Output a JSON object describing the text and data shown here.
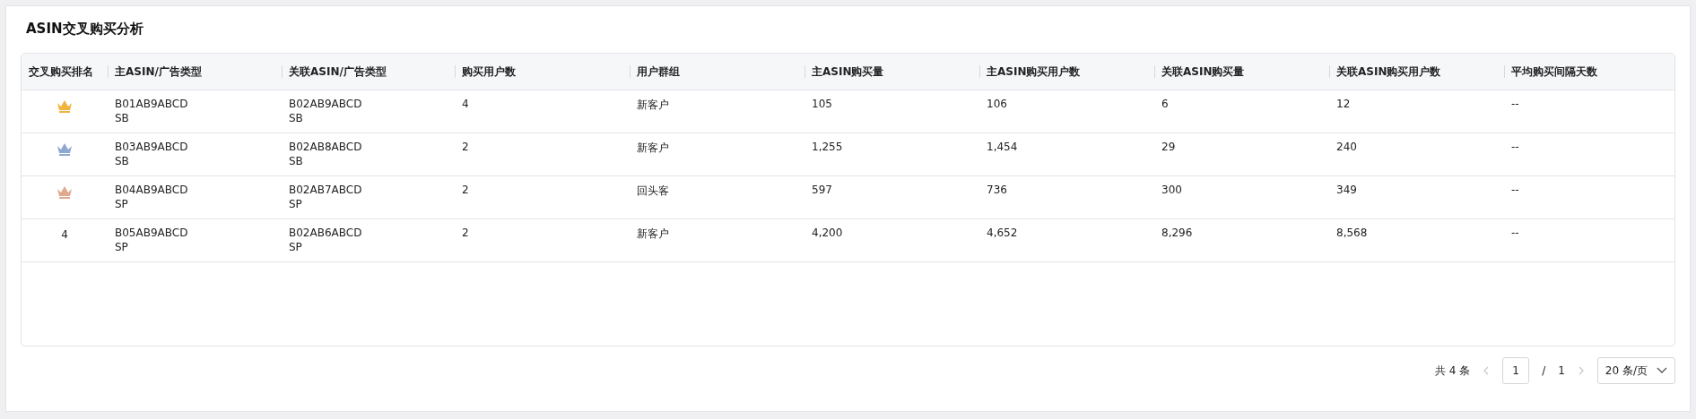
{
  "title": "ASIN交叉购买分析",
  "table": {
    "columns": [
      "交叉购买排名",
      "主ASIN/广告类型",
      "关联ASIN/广告类型",
      "购买用户数",
      "用户群组",
      "主ASIN购买量",
      "主ASIN购买用户数",
      "关联ASIN购买量",
      "关联ASIN购买用户数",
      "平均购买间隔天数"
    ],
    "rows": [
      {
        "rank": {
          "kind": "crown",
          "color": "#f2b33d"
        },
        "main_asin": "B01AB9ABCD",
        "main_ad_type": "SB",
        "related_asin": "B02AB9ABCD",
        "related_ad_type": "SB",
        "buyers": "4",
        "group": "新客户",
        "main_qty": "105",
        "main_buyers": "106",
        "related_qty": "6",
        "related_buyers": "12",
        "avg_interval": "--"
      },
      {
        "rank": {
          "kind": "crown",
          "color": "#8fa8d0"
        },
        "main_asin": "B03AB9ABCD",
        "main_ad_type": "SB",
        "related_asin": "B02AB8ABCD",
        "related_ad_type": "SB",
        "buyers": "2",
        "group": "新客户",
        "main_qty": "1,255",
        "main_buyers": "1,454",
        "related_qty": "29",
        "related_buyers": "240",
        "avg_interval": "--"
      },
      {
        "rank": {
          "kind": "crown",
          "color": "#e0a98f"
        },
        "main_asin": "B04AB9ABCD",
        "main_ad_type": "SP",
        "related_asin": "B02AB7ABCD",
        "related_ad_type": "SP",
        "buyers": "2",
        "group": "回头客",
        "main_qty": "597",
        "main_buyers": "736",
        "related_qty": "300",
        "related_buyers": "349",
        "avg_interval": "--"
      },
      {
        "rank": {
          "kind": "number",
          "text": "4"
        },
        "main_asin": "B05AB9ABCD",
        "main_ad_type": "SP",
        "related_asin": "B02AB6ABCD",
        "related_ad_type": "SP",
        "buyers": "2",
        "group": "新客户",
        "main_qty": "4,200",
        "main_buyers": "4,652",
        "related_qty": "8,296",
        "related_buyers": "8,568",
        "avg_interval": "--"
      }
    ]
  },
  "pagination": {
    "total": "共 4 条",
    "prev": {
      "disabled": true
    },
    "page": "1",
    "separator": "/",
    "pages": "1",
    "next": {
      "disabled": true
    },
    "page_size": "20 条/页"
  }
}
